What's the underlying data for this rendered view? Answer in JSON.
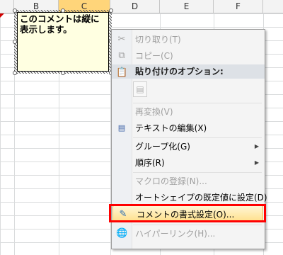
{
  "columns": [
    "B",
    "C",
    "D",
    "E",
    "F"
  ],
  "comment": {
    "text": "このコメントは縦に表示します。"
  },
  "menu": {
    "cut": "切り取り(T)",
    "copy": "コピー(C)",
    "paste_options_header": "貼り付けのオプション:",
    "reconvert": "再変換(V)",
    "edit_text": "テキストの編集(X)",
    "grouping": "グループ化(G)",
    "order": "順序(R)",
    "assign_macro": "マクロの登録(N)...",
    "set_default_shape": "オートシェイプの既定値に設定(D)",
    "format_comment": "コメントの書式設定(O)...",
    "hyperlink": "ハイパーリンク(H)..."
  },
  "colors": {
    "highlight_border": "#ff0000",
    "comment_bg": "#ffffe1"
  }
}
